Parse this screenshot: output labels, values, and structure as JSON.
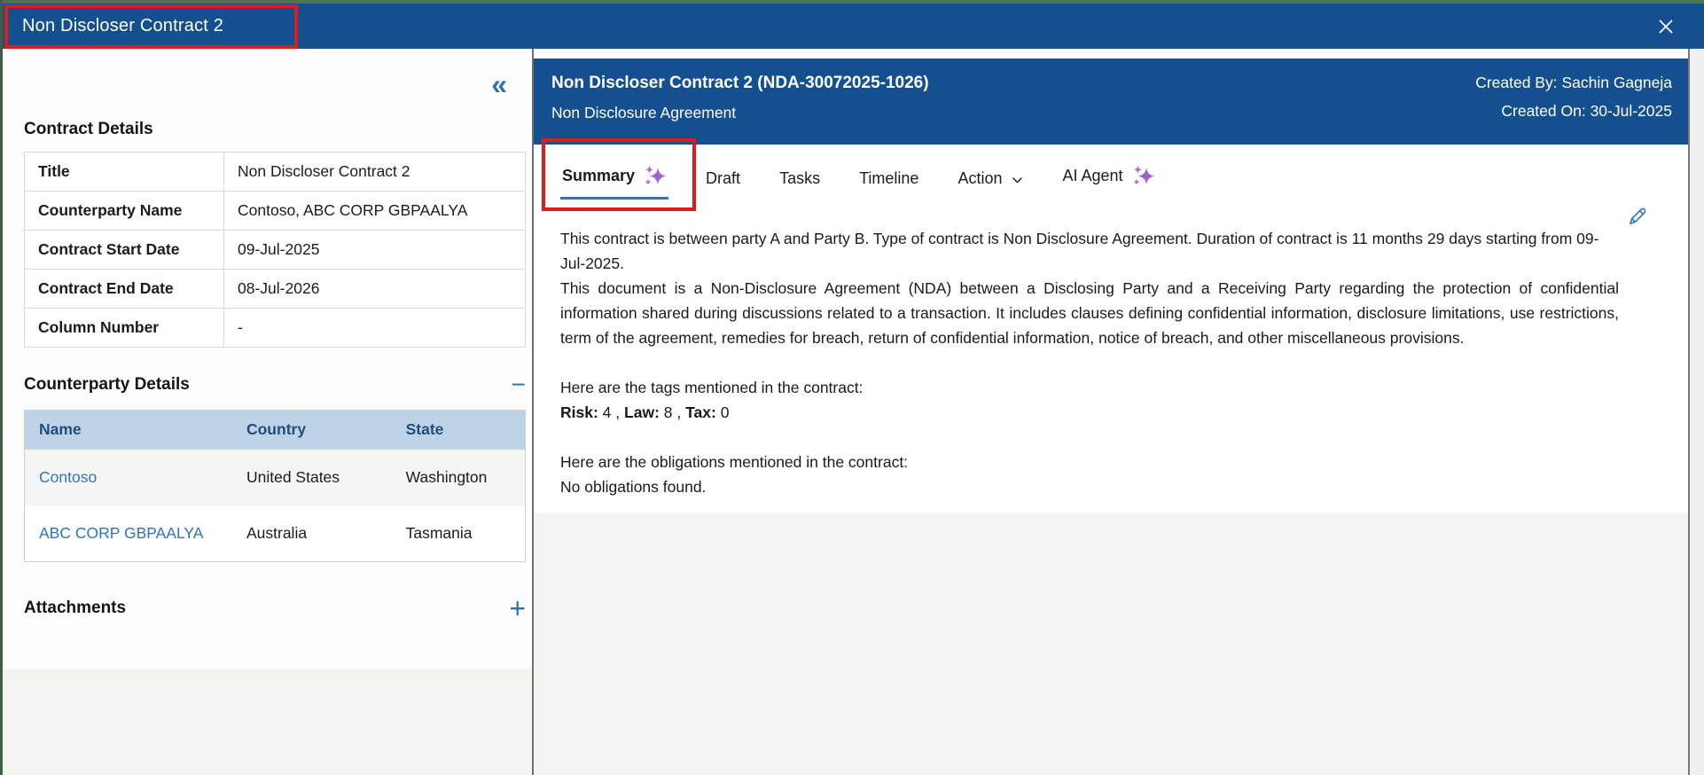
{
  "titlebar": {
    "title": "Non Discloser Contract 2"
  },
  "icons": {
    "collapse": "«",
    "collapse_section": "−",
    "expand_section": "+"
  },
  "colors": {
    "titlebar_blue": "#14508f",
    "accent_blue": "#2e75b6",
    "link_blue": "#2e75b6",
    "table_header_bg": "#bed3e8",
    "table_header_text": "#1f4e79",
    "annotation_red": "#dc1d1d",
    "bottom_gray": "#f3f3f2",
    "sparkle_purple": "#a15fd0",
    "window_edge_green": "#4c7551"
  },
  "sidebar": {
    "contract_details": {
      "heading": "Contract Details",
      "rows": [
        {
          "label": "Title",
          "value": "Non Discloser Contract 2"
        },
        {
          "label": "Counterparty Name",
          "value": "Contoso, ABC CORP GBPAALYA"
        },
        {
          "label": "Contract Start Date",
          "value": "09-Jul-2025"
        },
        {
          "label": "Contract End Date",
          "value": "08-Jul-2026"
        },
        {
          "label": "Column Number",
          "value": "-"
        }
      ]
    },
    "counterparty_details": {
      "heading": "Counterparty Details",
      "columns": [
        "Name",
        "Country",
        "State"
      ],
      "rows": [
        {
          "name": "Contoso",
          "country": "United States",
          "state": "Washington"
        },
        {
          "name": "ABC CORP GBPAALYA",
          "country": "Australia",
          "state": "Tasmania"
        }
      ]
    },
    "attachments": {
      "heading": "Attachments"
    }
  },
  "main": {
    "header": {
      "title": "Non Discloser Contract 2 (NDA-30072025-1026)",
      "subtitle": "Non Disclosure Agreement",
      "created_by": "Created By: Sachin Gagneja",
      "created_on": "Created On: 30-Jul-2025"
    },
    "tabs": {
      "summary": "Summary",
      "draft": "Draft",
      "tasks": "Tasks",
      "timeline": "Timeline",
      "action": "Action",
      "ai_agent": "AI Agent"
    },
    "summary": {
      "paragraph1": "This contract is between party A and Party B. Type of contract is Non Disclosure Agreement. Duration of contract is 11 months 29 days starting from 09-Jul-2025.",
      "paragraph2": "This document is a Non-Disclosure Agreement (NDA) between a Disclosing Party and a Receiving Party regarding the protection of confidential information shared during discussions related to a transaction. It includes clauses defining confidential information, disclosure limitations, use restrictions, term of the agreement, remedies for breach, return of confidential information, notice of breach, and other miscellaneous provisions.",
      "tags_intro": "Here are the tags mentioned in the contract:",
      "tags": [
        {
          "label": "Risk:",
          "value": "4"
        },
        {
          "label": "Law:",
          "value": "8"
        },
        {
          "label": "Tax:",
          "value": "0"
        }
      ],
      "tags_separator": ",",
      "obligations_intro": "Here are the obligations mentioned in the contract:",
      "obligations_text": "No obligations found."
    }
  }
}
